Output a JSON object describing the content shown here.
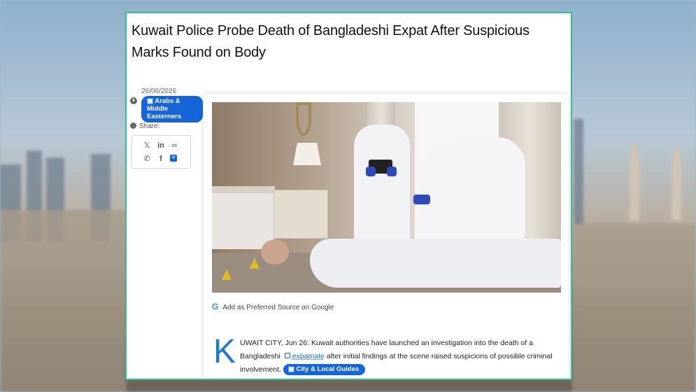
{
  "article": {
    "headline": "Kuwait Police Probe Death of Bangladeshi Expat After Suspicious Marks Found on Body",
    "date": "26/06/2026",
    "category": "Arabs & Middle Easterners",
    "share_label": "Share:",
    "share_icons": [
      "x-icon",
      "linkedin-icon",
      "link-icon",
      "whatsapp-icon",
      "facebook-icon",
      "plus-icon"
    ],
    "preferred_source": "Add as Preferred Source on Google",
    "dropcap": "K",
    "body_part1": "UWAIT CITY, Jun 26: Kuwait authorities have launched an investigation into the death of a Bangladeshi",
    "body_link": "expatriate",
    "body_part2": "after initial findings at the scene raised suspicions of possible criminal involvement.",
    "tag": "City & Local Guides"
  },
  "colors": {
    "frame_border": "#2dbf8f",
    "badge_blue": "#1565d8",
    "dropcap_blue": "#1d79c9"
  }
}
